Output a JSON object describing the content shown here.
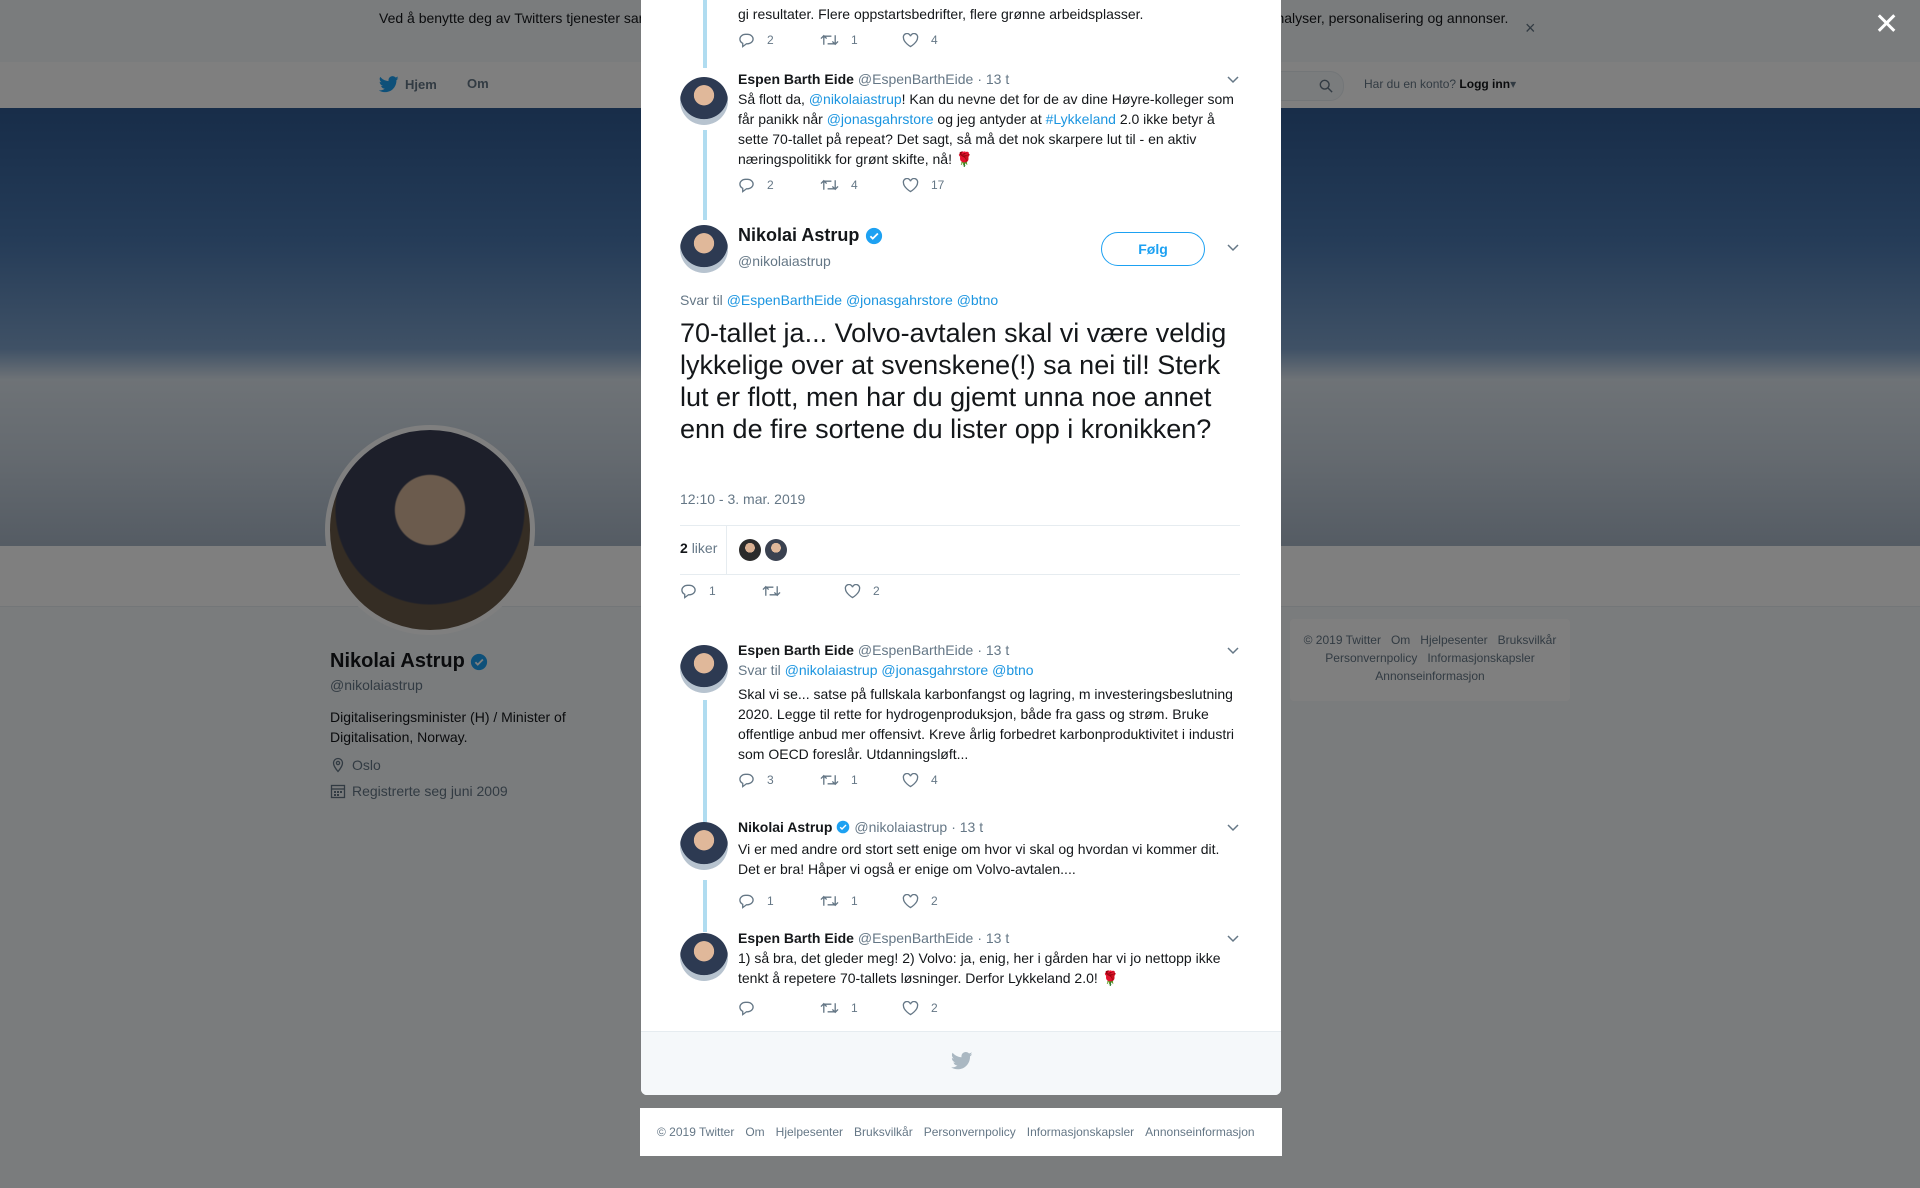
{
  "cookie": {
    "text": "Ved å benytte deg av Twitters tjenester samtykker du til vår bruk av informasjonskapsler. Vi og våre partnere bruker informasjonskapsler til bl.a. analyser, personalisering og annonser.",
    "close": "×"
  },
  "nav": {
    "home": "Hjem",
    "about": "Om",
    "login_prompt": "Har du en konto?",
    "login": "Logg inn"
  },
  "profile": {
    "name": "Nikolai Astrup",
    "handle": "@nikolaiastrup",
    "bio": "Digitaliseringsminister (H) / Minister of Digitalisation, Norway.",
    "location": "Oslo",
    "joined": "Registrerte seg juni 2009"
  },
  "side_footer": [
    "© 2019 Twitter",
    "Om",
    "Hjelpesenter",
    "Bruksvilkår",
    "Personvernpolicy",
    "Informasjonskapsler",
    "Annonseinformasjon"
  ],
  "thread": {
    "t0": {
      "text": "gi resultater. Flere oppstartsbedrifter, flere grønne arbeidsplasser.",
      "replies": "2",
      "retweets": "1",
      "likes": "4"
    },
    "t1": {
      "name": "Espen Barth Eide",
      "handle": "@EspenBarthEide",
      "time": "· 13 t",
      "text_a": "Så flott da, ",
      "mention1": "@nikolaiastrup",
      "text_b": "! Kan du nevne det for de av dine Høyre-kolleger som får panikk når ",
      "mention2": "@jonasgahrstore",
      "text_c": " og jeg antyder at ",
      "hashtag": "#Lykkeland",
      "text_d": " 2.0 ikke betyr å sette 70-tallet på repeat? Det sagt, så må det nok skarpere lut til - en aktiv næringspolitikk for grønt skifte, nå! 🌹",
      "replies": "2",
      "retweets": "4",
      "likes": "17"
    },
    "focus": {
      "name": "Nikolai Astrup",
      "handle": "@nikolaiastrup",
      "follow": "Følg",
      "reply_label": "Svar til",
      "reply_to": [
        "@EspenBarthEide",
        "@jonasgahrstore",
        "@btno"
      ],
      "text": "70-tallet ja... Volvo-avtalen skal vi være veldig lykkelige over at svenskene(!) sa nei til! Sterk lut er flott, men har du gjemt unna noe annet enn de fire sortene du lister opp i kronikken?",
      "timestamp": "12:10 - 3. mar. 2019",
      "likes_count": "2",
      "likes_label": "liker",
      "replies": "1",
      "retweets": "",
      "likes": "2"
    },
    "t2": {
      "name": "Espen Barth Eide",
      "handle": "@EspenBarthEide",
      "time": "· 13 t",
      "reply_label": "Svar til",
      "reply_to": [
        "@nikolaiastrup",
        "@jonasgahrstore",
        "@btno"
      ],
      "text": "Skal vi se... satse på fullskala karbonfangst og lagring, m investeringsbeslutning 2020. Legge til rette for hydrogenproduksjon, både fra gass og strøm. Bruke offentlige anbud mer offensivt. Kreve årlig forbedret karbonproduktivitet i industri som OECD foreslår. Utdanningsløft...",
      "replies": "3",
      "retweets": "1",
      "likes": "4"
    },
    "t3": {
      "name": "Nikolai Astrup",
      "handle": "@nikolaiastrup",
      "time": "· 13 t",
      "text": "Vi er med andre ord stort sett enige om hvor vi skal og hvordan vi kommer dit. Det er bra! Håper vi også er enige om Volvo-avtalen....",
      "replies": "1",
      "retweets": "1",
      "likes": "2"
    },
    "t4": {
      "name": "Espen Barth Eide",
      "handle": "@EspenBarthEide",
      "time": "· 13 t",
      "text": "1) så bra, det gleder meg! 2) Volvo: ja, enig, her i gården har vi jo nettopp ikke tenkt å repetere 70-tallets løsninger. Derfor Lykkeland 2.0! 🌹",
      "replies": "",
      "retweets": "1",
      "likes": "2"
    }
  },
  "footer": [
    "© 2019 Twitter",
    "Om",
    "Hjelpesenter",
    "Bruksvilkår",
    "Personvernpolicy",
    "Informasjonskapsler",
    "Annonseinformasjon"
  ],
  "colors": {
    "link": "#1b95e0",
    "accent": "#1da1f2",
    "thread_line": "#b0dcf0",
    "overlay": "rgba(0,0,0,0.5)"
  }
}
